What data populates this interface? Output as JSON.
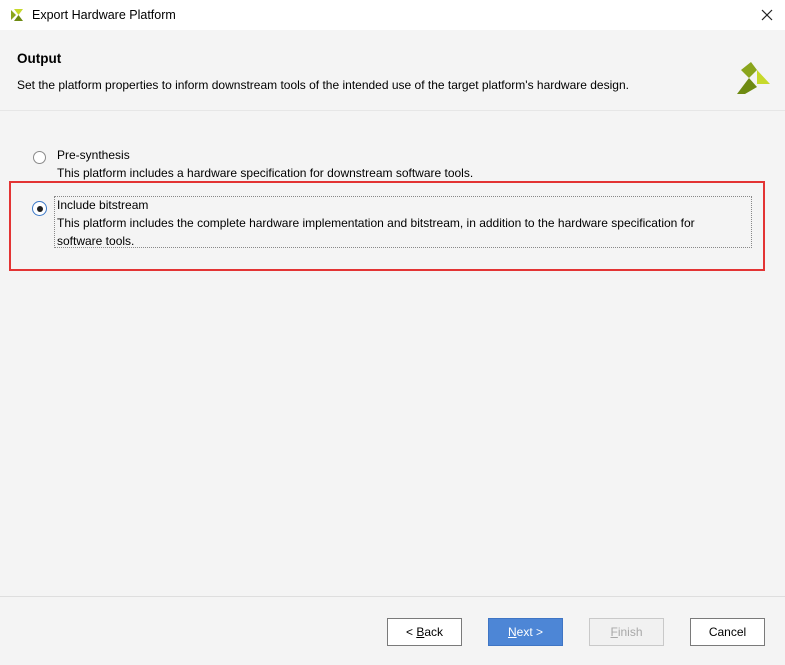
{
  "window": {
    "title": "Export Hardware Platform",
    "app_icon": "xilinx-logo-icon",
    "close_icon": "close-icon"
  },
  "header": {
    "title": "Output",
    "description": "Set the platform properties to inform downstream tools of the intended use of the target platform's hardware design.",
    "brand_icon": "xilinx-logo-icon",
    "brand_colors": [
      "#8aa51c",
      "#c7d92b",
      "#6e8a12"
    ]
  },
  "options": [
    {
      "label": "Pre-synthesis",
      "description_lines": [
        "This platform includes a hardware specification for downstream software tools."
      ],
      "selected": false
    },
    {
      "label": "Include bitstream",
      "description_lines": [
        "This platform includes the complete hardware implementation and bitstream, in addition to the hardware specification for",
        "software tools."
      ],
      "selected": true
    }
  ],
  "buttons": {
    "back": {
      "prefix": "< ",
      "mnemonic": "B",
      "rest": "ack"
    },
    "next": {
      "mnemonic": "N",
      "rest": "ext >"
    },
    "finish": {
      "mnemonic": "F",
      "rest": "inish"
    },
    "cancel": {
      "label": "Cancel"
    }
  },
  "colors": {
    "highlight": "#e33434",
    "primary_button": "#4d86d6",
    "radio_selected": "#3b78c7"
  }
}
